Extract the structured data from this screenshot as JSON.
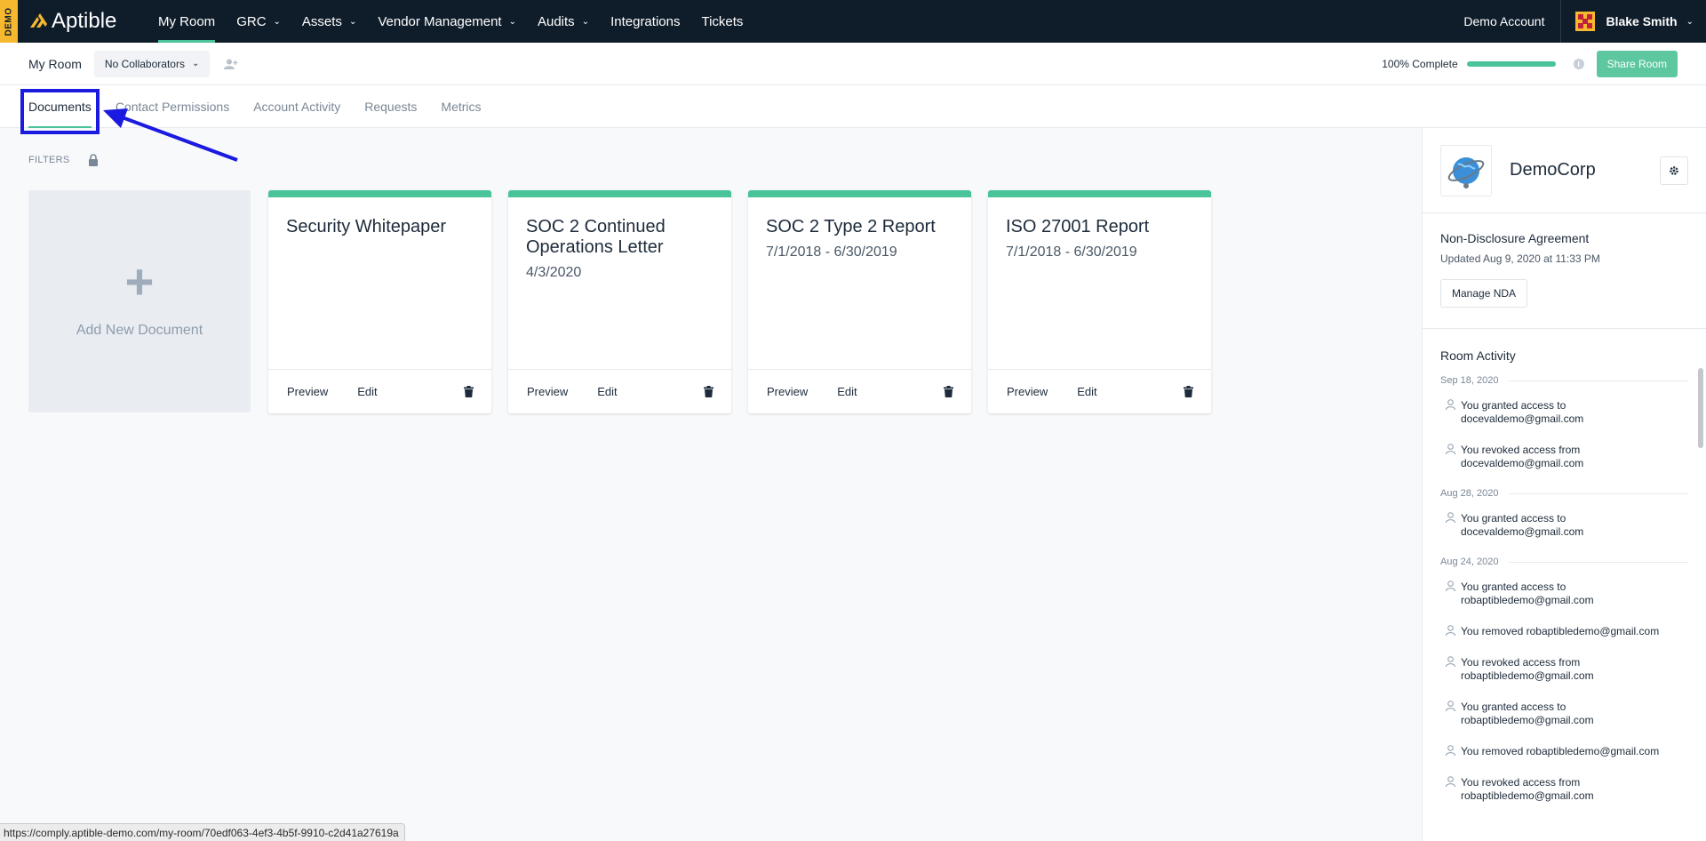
{
  "demo_tag": "DEMO",
  "brand": "Aptible",
  "nav": [
    {
      "label": "My Room",
      "dropdown": false,
      "active": true
    },
    {
      "label": "GRC",
      "dropdown": true
    },
    {
      "label": "Assets",
      "dropdown": true
    },
    {
      "label": "Vendor Management",
      "dropdown": true
    },
    {
      "label": "Audits",
      "dropdown": true
    },
    {
      "label": "Integrations",
      "dropdown": false
    },
    {
      "label": "Tickets",
      "dropdown": false
    }
  ],
  "account": "Demo Account",
  "user_name": "Blake Smith",
  "room": {
    "title": "My Room",
    "collaborators": "No Collaborators",
    "complete_label": "100% Complete",
    "progress": 1.0,
    "share_label": "Share Room"
  },
  "tabs": [
    "Documents",
    "Contact Permissions",
    "Account Activity",
    "Requests",
    "Metrics"
  ],
  "filters_label": "FILTERS",
  "add_document_label": "Add New Document",
  "documents": [
    {
      "title": "Security Whitepaper",
      "date": ""
    },
    {
      "title": "SOC 2 Continued Operations Letter",
      "date": "4/3/2020"
    },
    {
      "title": "SOC 2 Type 2 Report",
      "date": "7/1/2018 - 6/30/2019"
    },
    {
      "title": "ISO 27001 Report",
      "date": "7/1/2018 - 6/30/2019"
    }
  ],
  "card_actions": {
    "preview": "Preview",
    "edit": "Edit"
  },
  "company": "DemoCorp",
  "nda": {
    "title": "Non-Disclosure Agreement",
    "updated": "Updated Aug 9, 2020 at 11:33 PM",
    "button": "Manage NDA"
  },
  "activity": {
    "title": "Room Activity",
    "d1": "Sep 18, 2020",
    "a1": "You granted access to docevaldemo@gmail.com",
    "a2": "You revoked access from docevaldemo@gmail.com",
    "d2": "Aug 28, 2020",
    "a3": "You granted access to docevaldemo@gmail.com",
    "d3": "Aug 24, 2020",
    "a4": "You granted access to robaptibledemo@gmail.com",
    "a5": "You removed robaptibledemo@gmail.com",
    "a6": "You revoked access from robaptibledemo@gmail.com",
    "a7": "You granted access to robaptibledemo@gmail.com",
    "a8": "You removed robaptibledemo@gmail.com",
    "a9": "You revoked access from robaptibledemo@gmail.com"
  },
  "status_url": "https://comply.aptible-demo.com/my-room/70edf063-4ef3-4b5f-9910-c2d41a27619a",
  "colors": {
    "nav_bg": "#0f1d2b",
    "accent": "#49c499",
    "demo": "#f5b82e",
    "annotation": "#1a1ae0"
  }
}
